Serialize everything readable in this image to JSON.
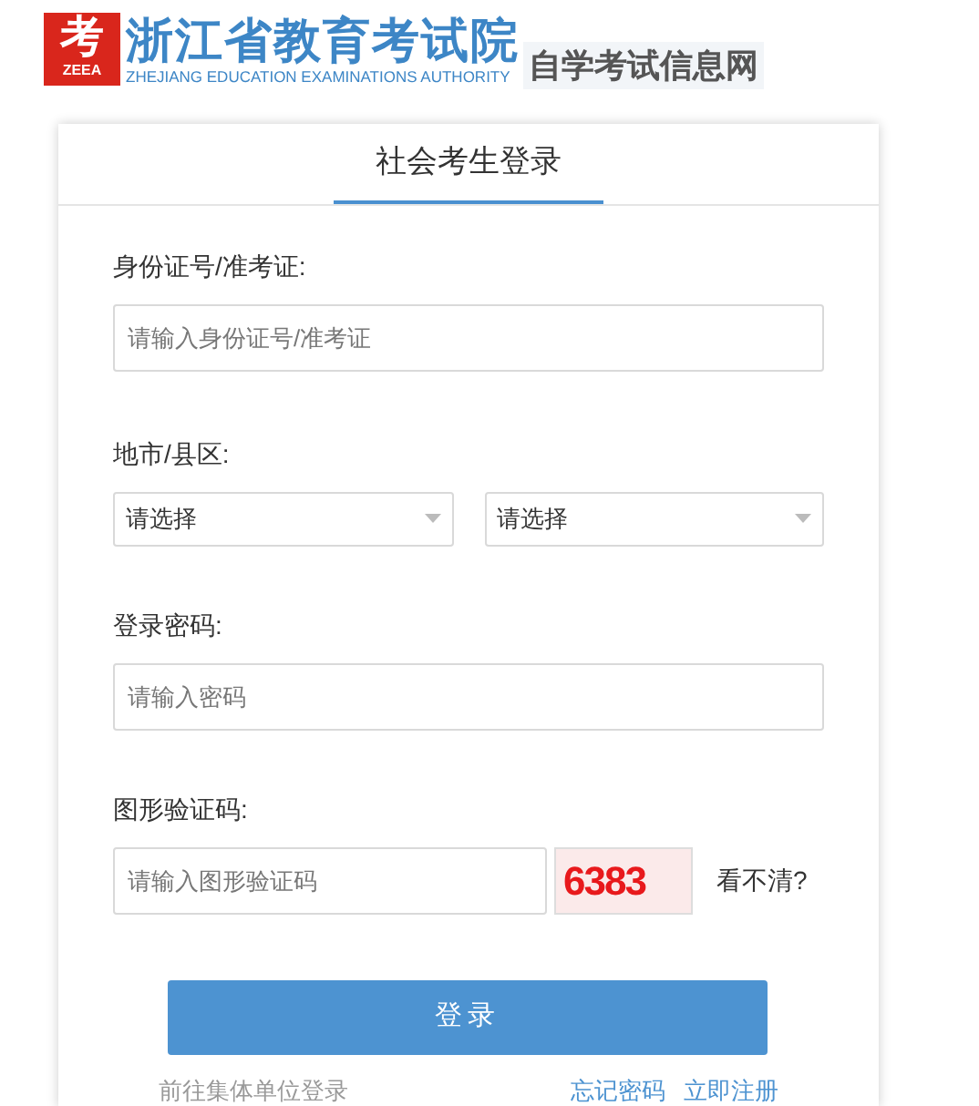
{
  "header": {
    "logo_mark": "考",
    "logo_abbr": "ZEEA",
    "title": "浙江省教育考试院",
    "subtitle": "ZHEJIANG EDUCATION EXAMINATIONS AUTHORITY",
    "site_name": "自学考试信息网"
  },
  "login": {
    "tabs": [
      {
        "label": "社会考生登录",
        "selected": true
      }
    ],
    "id_field": {
      "label": "身份证号/准考证:",
      "placeholder": "请输入身份证号/准考证"
    },
    "region": {
      "label": "地市/县区:",
      "selects": [
        {
          "value": "请选择"
        },
        {
          "value": "请选择"
        }
      ]
    },
    "password_field": {
      "label": "登录密码:",
      "placeholder": "请输入密码"
    },
    "captcha": {
      "label": "图形验证码:",
      "placeholder": "请输入图形验证码",
      "code": "6383",
      "refresh": "看不清?"
    },
    "submit": "登录",
    "links": {
      "group_login": "前往集体单位登录",
      "forgot": "忘记密码",
      "register": "立即注册"
    }
  }
}
